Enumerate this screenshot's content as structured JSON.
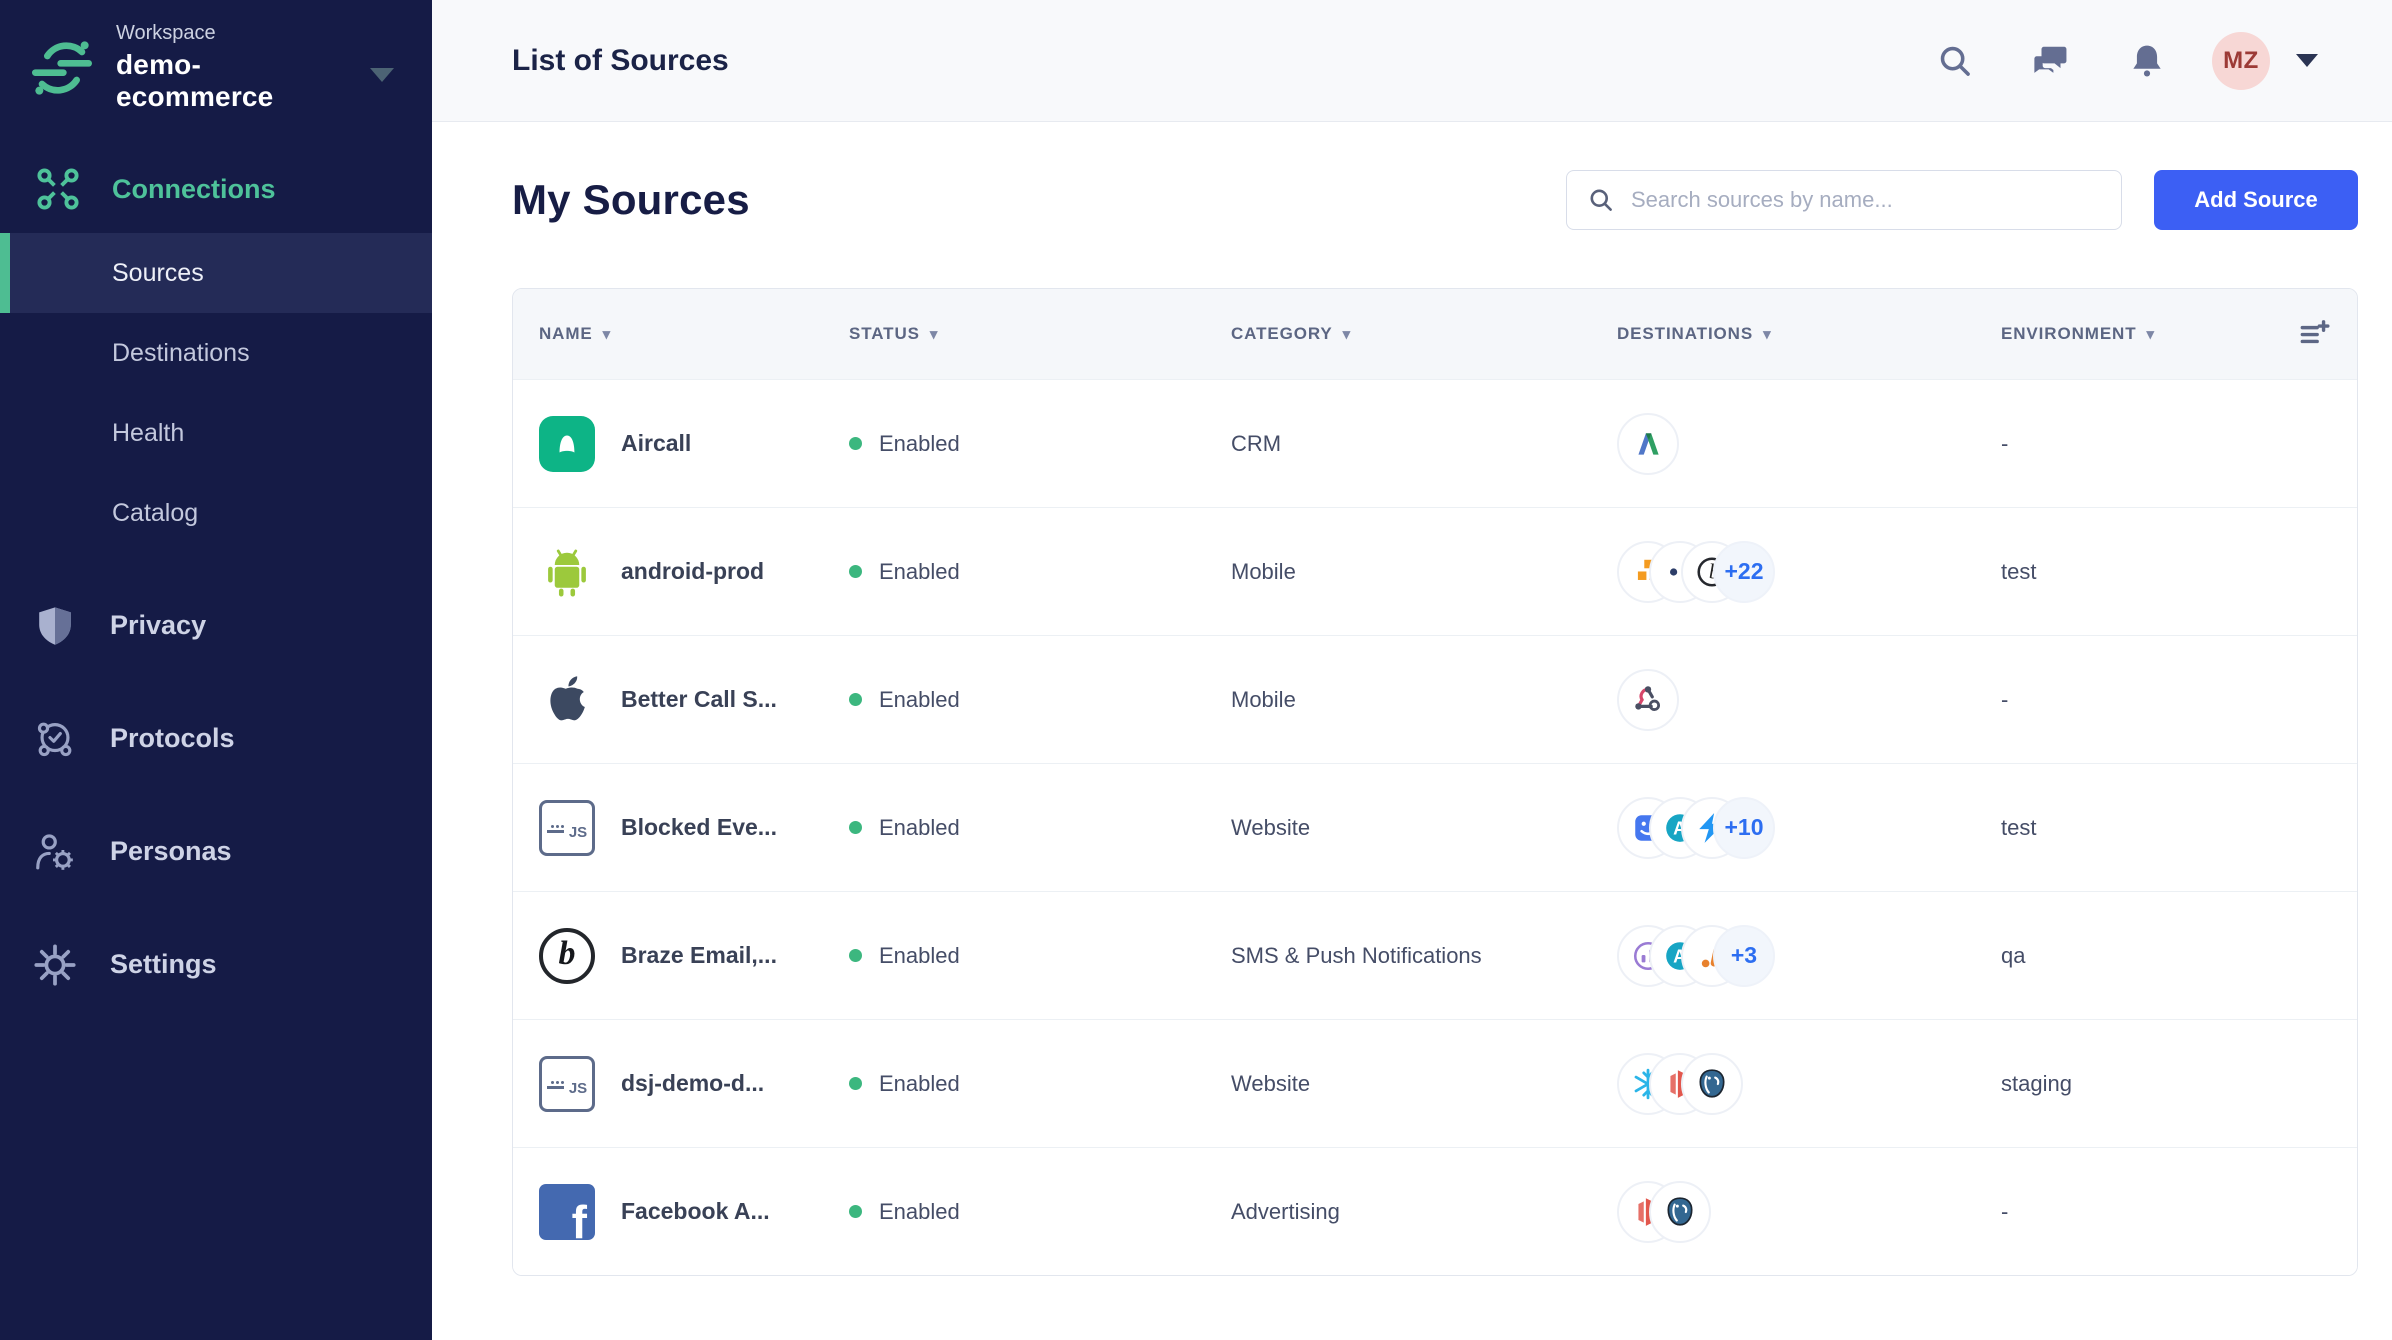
{
  "sidebar": {
    "workspace_label": "Workspace",
    "workspace_name": "demo-ecommerce",
    "nav": {
      "connections": "Connections",
      "sources": "Sources",
      "destinations": "Destinations",
      "health": "Health",
      "catalog": "Catalog",
      "privacy": "Privacy",
      "protocols": "Protocols",
      "personas": "Personas",
      "settings": "Settings"
    }
  },
  "topbar": {
    "title": "List of Sources",
    "avatar_initials": "MZ"
  },
  "content": {
    "heading": "My Sources",
    "search_placeholder": "Search sources by name...",
    "add_source_label": "Add Source"
  },
  "table": {
    "headers": {
      "name": "NAME",
      "status": "STATUS",
      "category": "CATEGORY",
      "destinations": "DESTINATIONS",
      "environment": "ENVIRONMENT"
    },
    "rows": [
      {
        "name": "Aircall",
        "source_icon": "aircall-icon",
        "status": "Enabled",
        "category": "CRM",
        "destination_icons": [
          "google-ads-icon"
        ],
        "more_count": "",
        "environment": "-"
      },
      {
        "name": "android-prod",
        "source_icon": "android-icon",
        "status": "Enabled",
        "category": "Mobile",
        "destination_icons": [
          "aws-icon",
          "dots-icon",
          "braze-icon"
        ],
        "more_count": "+22",
        "environment": "test"
      },
      {
        "name": "Better Call S...",
        "source_icon": "apple-icon",
        "status": "Enabled",
        "category": "Mobile",
        "destination_icons": [
          "webhook-icon"
        ],
        "more_count": "",
        "environment": "-"
      },
      {
        "name": "Blocked Eve...",
        "source_icon": "javascript-icon",
        "status": "Enabled",
        "category": "Website",
        "destination_icons": [
          "blue-app-icon",
          "teal-a-icon",
          "lightning-icon"
        ],
        "more_count": "+10",
        "environment": "test"
      },
      {
        "name": "Braze Email,...",
        "source_icon": "braze-icon",
        "status": "Enabled",
        "category": "SMS & Push Notifications",
        "destination_icons": [
          "purple-chart-icon",
          "teal-a-icon",
          "orange-dots-icon"
        ],
        "more_count": "+3",
        "environment": "qa"
      },
      {
        "name": "dsj-demo-d...",
        "source_icon": "javascript-icon",
        "status": "Enabled",
        "category": "Website",
        "destination_icons": [
          "snowflake-icon",
          "redshift-icon",
          "postgres-icon"
        ],
        "more_count": "",
        "environment": "staging"
      },
      {
        "name": "Facebook A...",
        "source_icon": "facebook-icon",
        "status": "Enabled",
        "category": "Advertising",
        "destination_icons": [
          "redshift-icon",
          "postgres-icon"
        ],
        "more_count": "",
        "environment": "-"
      }
    ]
  },
  "colors": {
    "sidebar_bg": "#151b46",
    "accent_green": "#4ebd92",
    "primary_button_blue": "#3c5ff4",
    "status_green": "#3cb77f",
    "more_badge_blue": "#2d6ef1"
  }
}
